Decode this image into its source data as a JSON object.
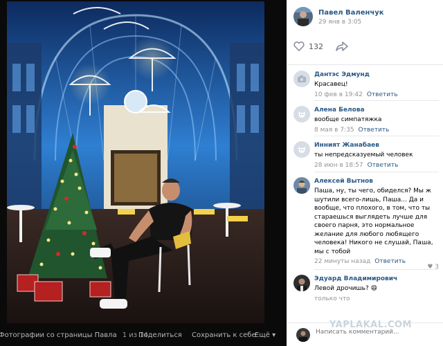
{
  "viewer": {
    "footer_source": "Фотографии со страницы Павла",
    "footer_counter": "1 из 14",
    "actions": [
      "Поделиться",
      "Сохранить к себе",
      "Ещё ▾"
    ]
  },
  "post": {
    "author_name": "Павел Валенчук",
    "date": "29 янв в 3:05",
    "likes_count": "132"
  },
  "comments": [
    {
      "name": "Дантэс Эдмунд",
      "text": "Красавец!",
      "time": "10 фев в 19:42",
      "reply": "Ответить",
      "likes": "",
      "avatar": "camera-placeholder"
    },
    {
      "name": "Алена Белова",
      "text": "вообще симпатяжка",
      "time": "8 мая в 7:35",
      "reply": "Ответить",
      "likes": "",
      "avatar": "dog-placeholder"
    },
    {
      "name": "Инният Жанабаев",
      "text": "ты непредсказуемый человек",
      "time": "28 июн в 18:57",
      "reply": "Ответить",
      "likes": "",
      "avatar": "dog-placeholder"
    },
    {
      "name": "Алексей Вытнов",
      "text": "Паша, ну, ты чего, обиделся? Мы ж шутили всего-лишь, Паша... Да и вообще, что плохого, в том, что ты стараешься выглядеть лучше для своего парня, это нормальное желание для любого любящего человека! Никого не слушай, Паша, мы с тобой",
      "time": "22 минуты назад",
      "reply": "Ответить",
      "likes": "3",
      "avatar": "photo"
    },
    {
      "name": "Эдуард Владимирович",
      "text": "Левой дрочишь? 😄",
      "time": "только что",
      "reply": "",
      "likes": "",
      "avatar": "photo-dark"
    }
  ],
  "composer": {
    "placeholder": "Написать комментарий..."
  },
  "watermark": "YAPLAKAL.COM",
  "colors": {
    "link": "#2a5885",
    "muted": "#939393",
    "panel_bg": "#ffffff",
    "viewer_bg": "#0a0a0a"
  }
}
